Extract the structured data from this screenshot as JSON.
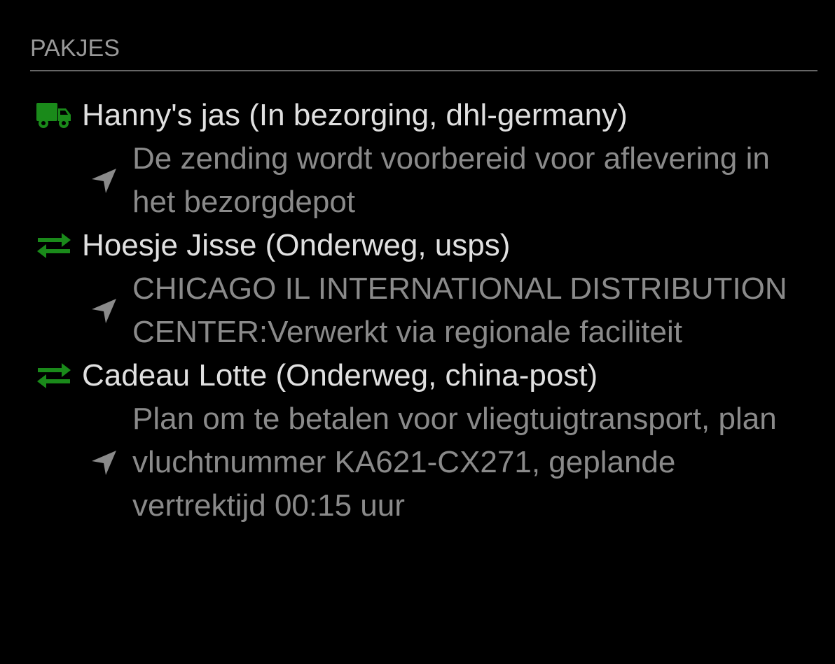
{
  "module": {
    "header": "PAKJES"
  },
  "parcels": [
    {
      "title": "Hanny's jas (In bezorging, dhl-germany)",
      "status_icon": "truck-icon",
      "detail": "De zending wordt voorbereid voor aflevering in het bezorgdepot"
    },
    {
      "title": "Hoesje Jisse (Onderweg, usps)",
      "status_icon": "exchange-arrows-icon",
      "detail": "CHICAGO IL INTERNATIONAL DISTRIBUTION CENTER:Verwerkt via regionale faciliteit"
    },
    {
      "title": "Cadeau Lotte (Onderweg, china-post)",
      "status_icon": "exchange-arrows-icon",
      "detail": "Plan om te betalen voor vliegtuigtransport, plan vluchtnummer KA621-CX271, geplande vertrektijd 00:15 uur"
    }
  ],
  "colors": {
    "background": "#000000",
    "status_icon": "#1a8a1a",
    "title_text": "#e0e0e0",
    "detail_text": "#8a8a8a",
    "header_text": "#999999",
    "divider": "#666666"
  }
}
